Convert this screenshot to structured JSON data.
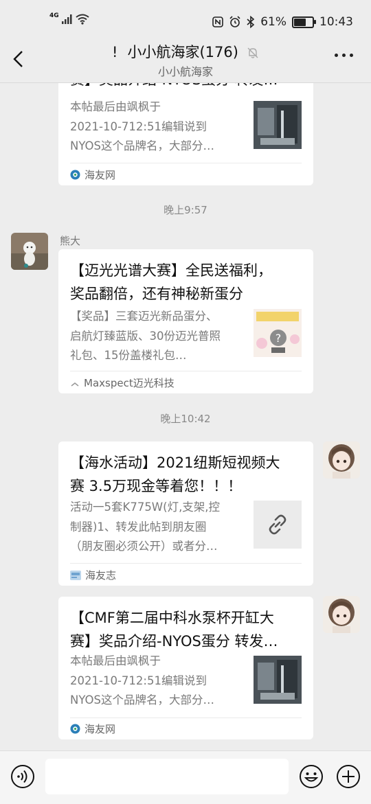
{
  "status_bar": {
    "network": "4G",
    "battery_percent": "61%",
    "battery_level": 0.61,
    "time": "10:43"
  },
  "header": {
    "warning": "!",
    "title": "小小航海家(176)",
    "subtitle": "小小航海家"
  },
  "messages": [
    {
      "title_partial": "赛】奖品介绍-NYOS蛋分 转发…",
      "desc": [
        "本帖最后由飒枫于",
        "2021-10-712:51编辑说到",
        "NYOS这个品牌名，大部分…"
      ],
      "source": "海友网"
    },
    {
      "time": "晚上9:57",
      "sender": "熊大",
      "title": [
        "【迈光光谱大赛】全民送福利，",
        "奖品翻倍，还有神秘新蛋分"
      ],
      "desc": [
        "【奖品】三套迈光新品蛋分、",
        "启航灯臻蓝版、30份迈光普照",
        "礼包、15份盖楼礼包…"
      ],
      "source": "Maxspect迈光科技"
    },
    {
      "time": "晚上10:42",
      "title": [
        "【海水活动】2021纽斯短视频大",
        "赛 3.5万现金等着您！！！"
      ],
      "desc": [
        "活动一5套K775W(灯,支架,控",
        "制器)1、转发此帖到朋友圈",
        "（朋友圈必须公开）或者分…"
      ],
      "source": "海友志"
    },
    {
      "title": [
        "【CMF第二届中科水泵杯开缸大",
        "赛】奖品介绍-NYOS蛋分 转发…"
      ],
      "desc": [
        "本帖最后由飒枫于",
        "2021-10-712:51编辑说到",
        "NYOS这个品牌名，大部分…"
      ],
      "source": "海友网"
    }
  ],
  "icons": {
    "back": "chevron-left-icon",
    "mute": "bell-off-icon",
    "more": "more-horizontal-icon",
    "link": "link-icon",
    "voice": "voice-icon",
    "emoji": "emoji-icon",
    "plus": "plus-icon"
  },
  "colors": {
    "background": "#ededed",
    "card": "#ffffff",
    "secondary_text": "#7a7a7a"
  }
}
